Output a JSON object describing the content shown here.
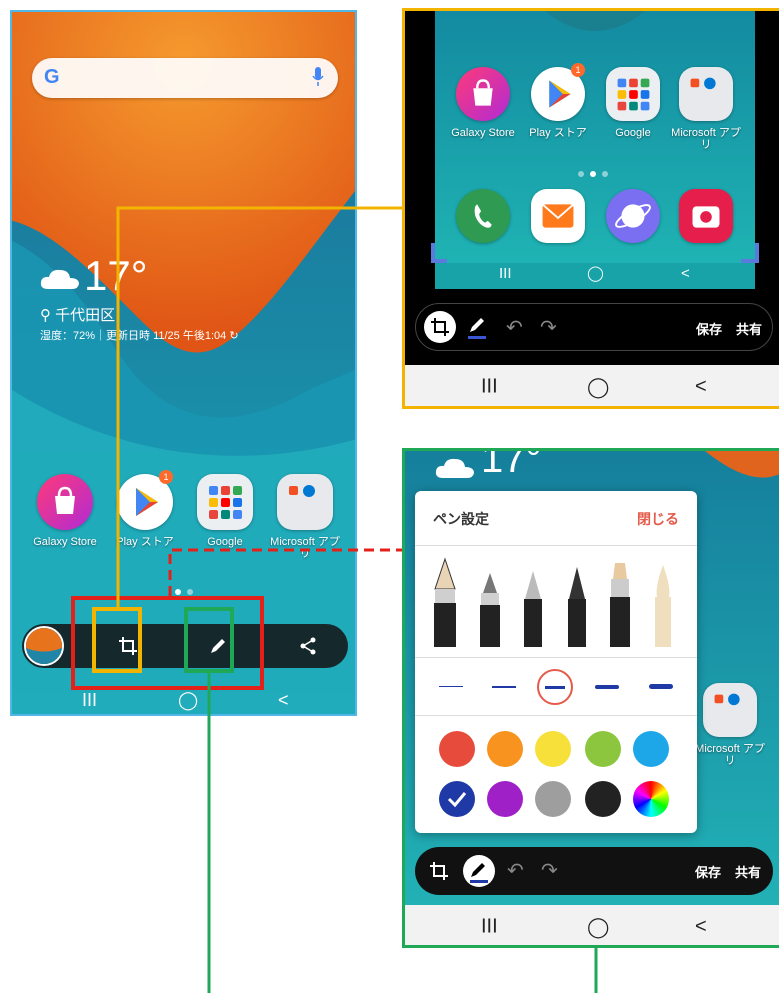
{
  "left_phone": {
    "search": {
      "logo": "G",
      "mic_icon": "mic-icon"
    },
    "weather": {
      "temperature": "17°",
      "location": "千代田区",
      "info": "湿度：72%｜更新日時 11/25 午後1:04"
    },
    "apps": [
      {
        "label": "Galaxy Store"
      },
      {
        "label": "Play ストア",
        "badge": "1"
      },
      {
        "label": "Google"
      },
      {
        "label": "Microsoft アプリ"
      }
    ],
    "toolbar": {
      "icons": [
        "thumbnail",
        "crop-icon",
        "pen-icon",
        "share-icon"
      ]
    },
    "nav": {
      "recent": "III",
      "home": "◯",
      "back": "<"
    }
  },
  "panel_top": {
    "apps": [
      {
        "label": "Galaxy Store"
      },
      {
        "label": "Play ストア",
        "badge": "1"
      },
      {
        "label": "Google"
      },
      {
        "label": "Microsoft アプリ"
      }
    ],
    "inner_nav": {
      "recent": "III",
      "home": "◯",
      "back": "<"
    },
    "edit_bar": {
      "save": "保存",
      "share": "共有"
    },
    "nav": {
      "recent": "III",
      "home": "◯",
      "back": "<"
    }
  },
  "panel_bottom": {
    "peek_temperature": "17°",
    "pen_settings": {
      "title": "ペン設定",
      "close": "閉じる",
      "pens": [
        "fountain-pen",
        "calligraphy-pen",
        "pencil",
        "marker-pen",
        "highlighter",
        "brush"
      ],
      "thickness_selected_index": 2,
      "colors": [
        "#e74b3c",
        "#f7931e",
        "#f8e03b",
        "#8cc63f",
        "#1ea7e8",
        "#1f3aa6",
        "#a020c8",
        "#9e9e9e",
        "#222222",
        "rainbow"
      ],
      "selected_color_index": 5
    },
    "side_app": {
      "label": "Microsoft アプリ"
    },
    "edit_bar": {
      "save": "保存",
      "share": "共有"
    },
    "nav": {
      "recent": "III",
      "home": "◯",
      "back": "<"
    }
  },
  "colors": {
    "left_border": "#52b6e6",
    "crop_highlight": "#f3b400",
    "pen_highlight": "#1fa855",
    "toolbar_highlight": "#e32118",
    "dashed_connector": "#e32118"
  }
}
